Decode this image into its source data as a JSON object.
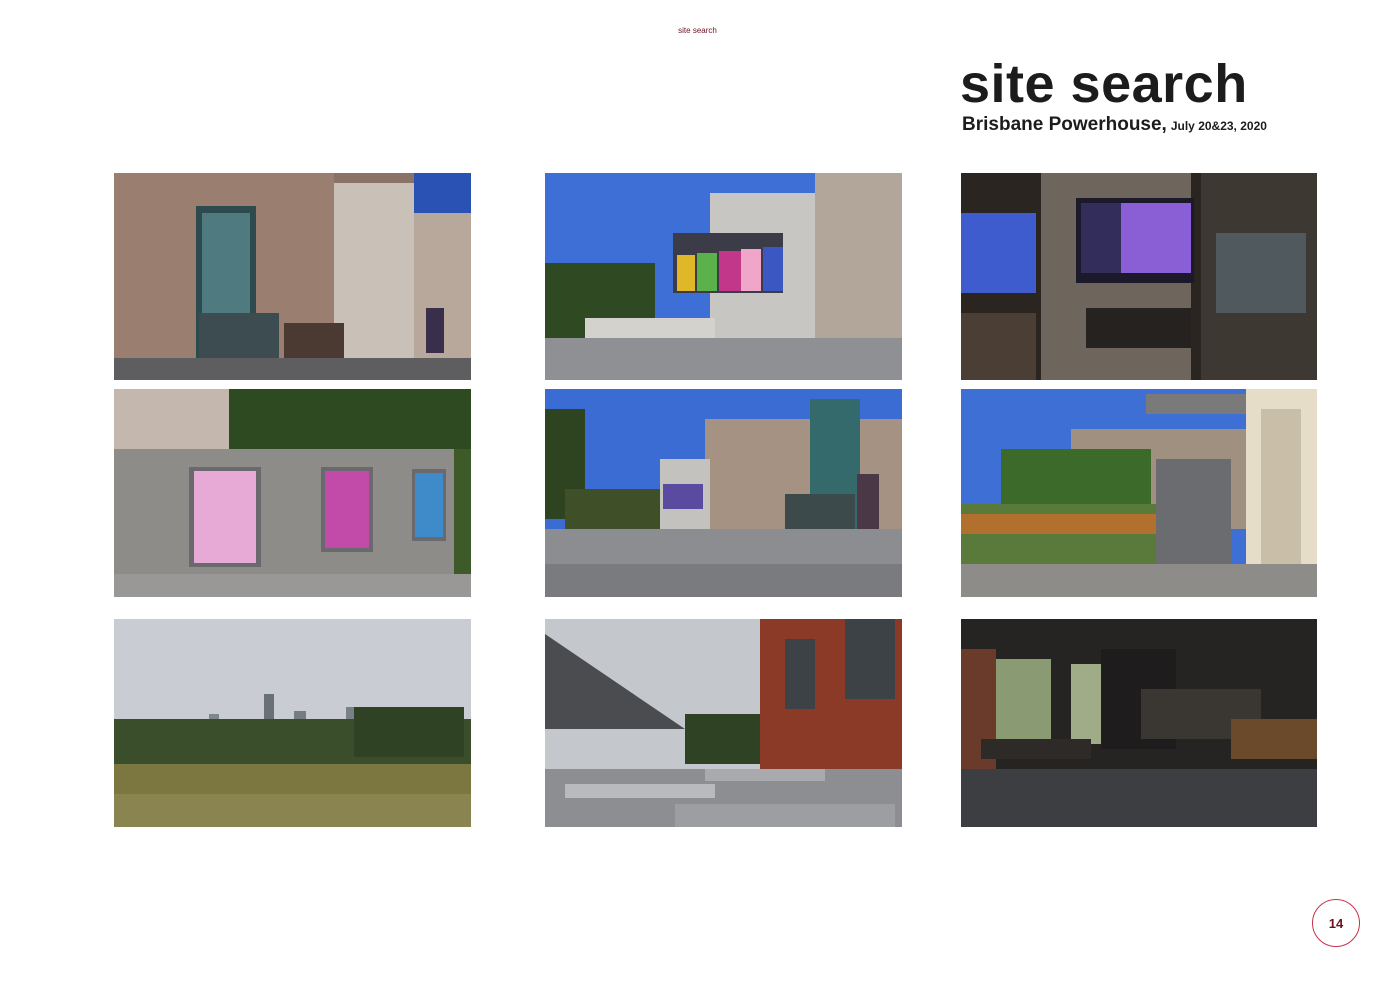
{
  "header": {
    "running_title": "site search"
  },
  "title": "site search",
  "subtitle": {
    "location": "Brisbane Powerhouse,",
    "dates": "July 20&23, 2020"
  },
  "photos": [
    {
      "name": "powerhouse-facade-glass-lift-photo"
    },
    {
      "name": "forecourt-billboards-photo"
    },
    {
      "name": "interior-screen-signage-photo"
    },
    {
      "name": "concrete-wall-posters-photo"
    },
    {
      "name": "plaza-brick-building-photo"
    },
    {
      "name": "stairs-greenery-photo"
    },
    {
      "name": "park-city-skyline-photo"
    },
    {
      "name": "outdoor-terrace-tables-photo"
    },
    {
      "name": "performance-hall-interior-photo"
    }
  ],
  "page_number": "14"
}
